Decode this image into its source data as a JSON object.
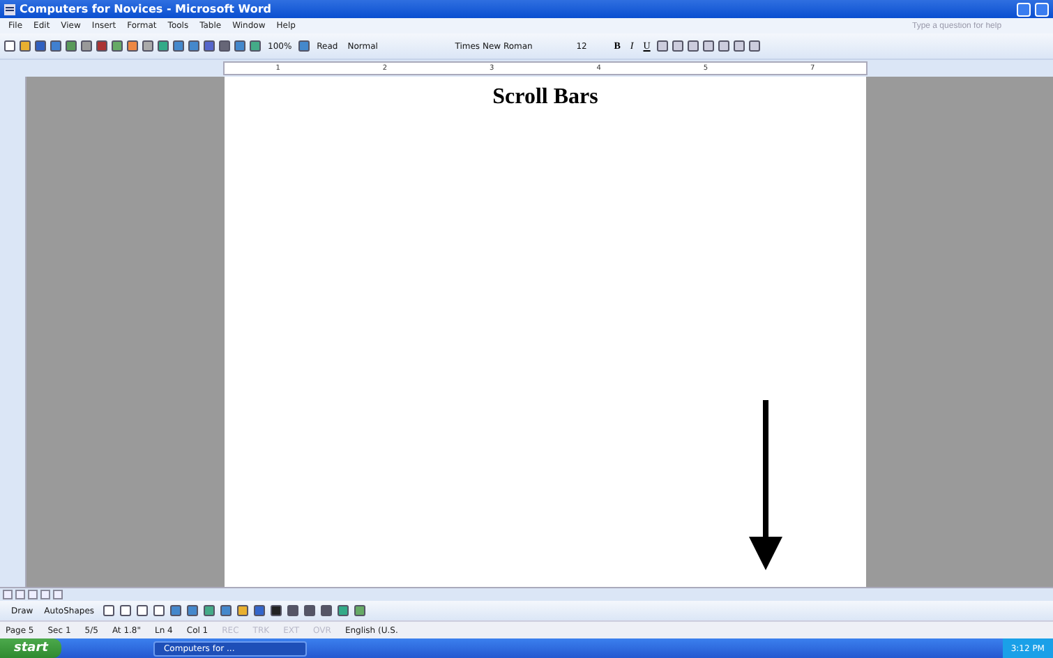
{
  "window": {
    "title": "Computers for Novices - Microsoft Word"
  },
  "menu": [
    "File",
    "Edit",
    "View",
    "Insert",
    "Format",
    "Tools",
    "Table",
    "Window",
    "Help"
  ],
  "help_box": {
    "placeholder": "Type a question for help"
  },
  "toolbar": {
    "zoom": "100%",
    "read": "Read",
    "style": "Normal",
    "font": "Times New Roman",
    "size": "12",
    "bold": "B",
    "italic": "I",
    "underline": "U"
  },
  "ruler": [
    "1",
    "2",
    "3",
    "4",
    "5",
    "7"
  ],
  "document": {
    "heading": "Scroll Bars"
  },
  "drawing_toolbar": {
    "draw": "Draw",
    "autoshapes": "AutoShapes"
  },
  "status_bar": [
    {
      "text": "Page 5",
      "disabled": false
    },
    {
      "text": "Sec 1",
      "disabled": false
    },
    {
      "text": "5/5",
      "disabled": false
    },
    {
      "text": "At 1.8\"",
      "disabled": false
    },
    {
      "text": "Ln 4",
      "disabled": false
    },
    {
      "text": "Col 1",
      "disabled": false
    },
    {
      "text": "REC",
      "disabled": true
    },
    {
      "text": "TRK",
      "disabled": true
    },
    {
      "text": "EXT",
      "disabled": true
    },
    {
      "text": "OVR",
      "disabled": true
    },
    {
      "text": "English (U.S.",
      "disabled": false
    }
  ],
  "taskbar": {
    "start": "start",
    "task": "Computers for ...",
    "clock": "3:12 PM"
  }
}
